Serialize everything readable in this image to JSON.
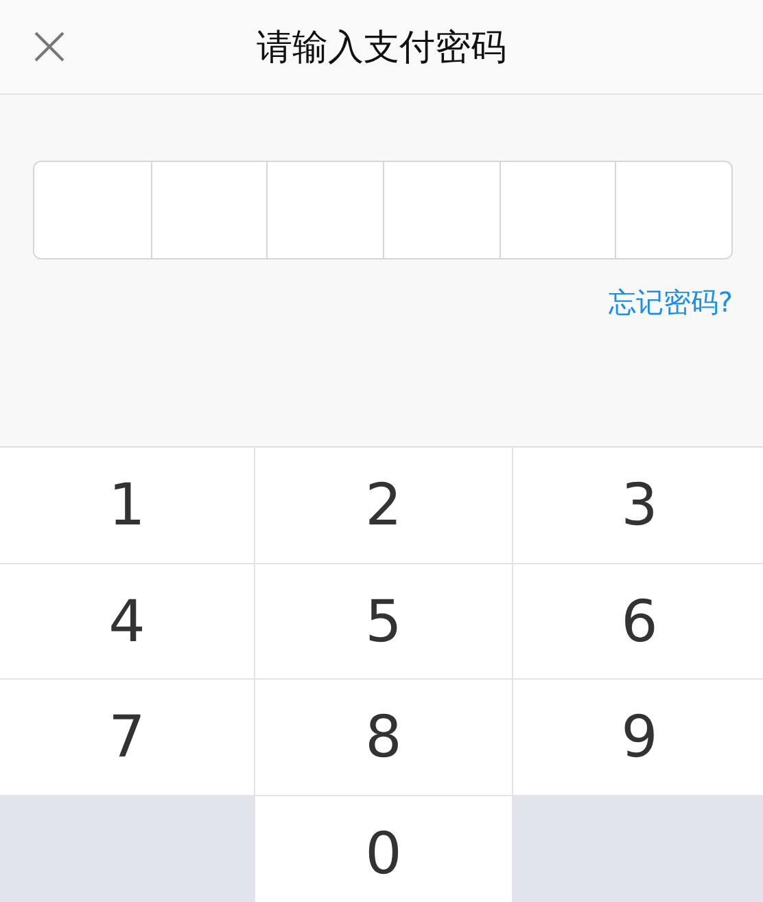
{
  "header": {
    "title": "请输入支付密码"
  },
  "password": {
    "cells": [
      {
        "filled": false
      },
      {
        "filled": false
      },
      {
        "filled": false
      },
      {
        "filled": false
      },
      {
        "filled": false
      },
      {
        "filled": false
      }
    ]
  },
  "forgot_link": "忘记密码?",
  "keypad": [
    {
      "kind": "digit",
      "label": "1"
    },
    {
      "kind": "digit",
      "label": "2"
    },
    {
      "kind": "digit",
      "label": "3"
    },
    {
      "kind": "digit",
      "label": "4"
    },
    {
      "kind": "digit",
      "label": "5"
    },
    {
      "kind": "digit",
      "label": "6"
    },
    {
      "kind": "digit",
      "label": "7"
    },
    {
      "kind": "digit",
      "label": "8"
    },
    {
      "kind": "digit",
      "label": "9"
    },
    {
      "kind": "blank"
    },
    {
      "kind": "digit",
      "label": "0"
    },
    {
      "kind": "blank"
    }
  ]
}
